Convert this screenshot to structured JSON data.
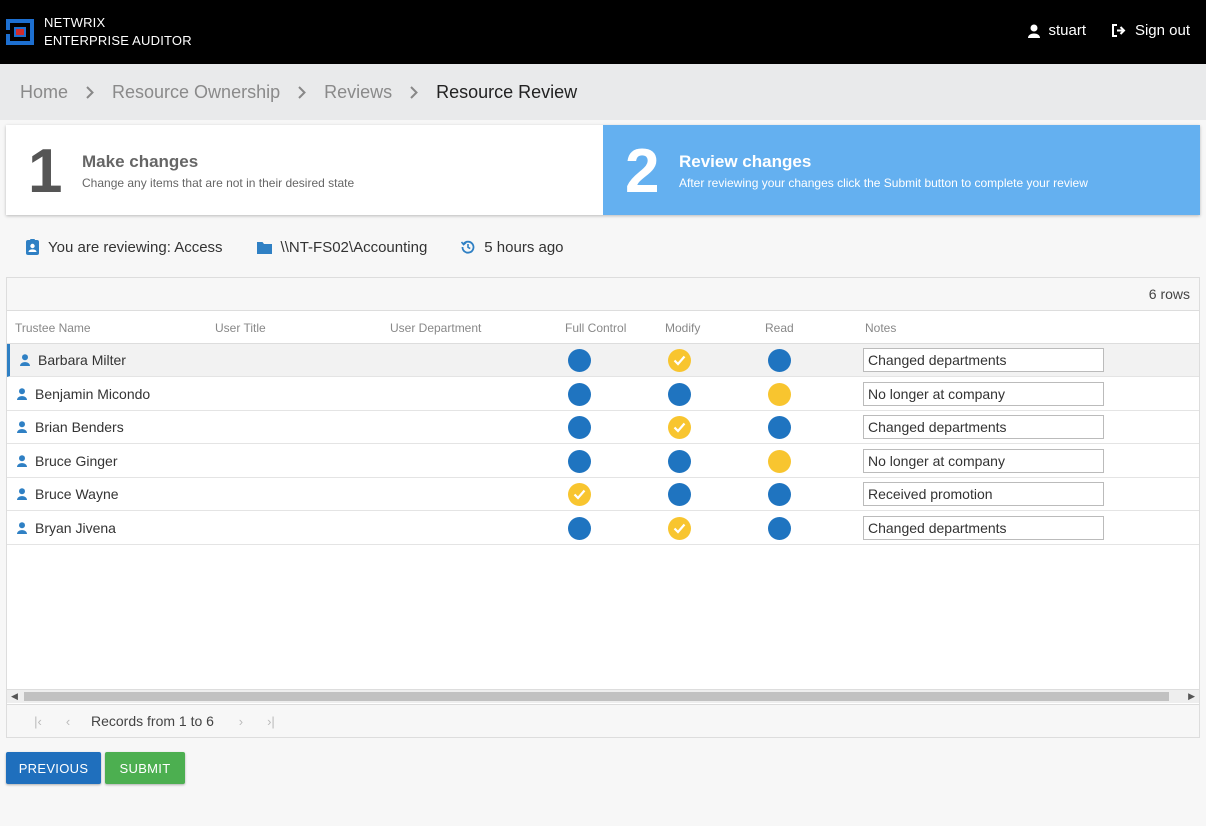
{
  "header": {
    "brand_line1": "NETWRIX",
    "brand_line2": "ENTERPRISE AUDITOR",
    "username": "stuart",
    "signout_label": "Sign out"
  },
  "breadcrumb": {
    "items": [
      "Home",
      "Resource Ownership",
      "Reviews"
    ],
    "current": "Resource Review"
  },
  "steps": [
    {
      "number": "1",
      "title": "Make changes",
      "description": "Change any items that are not in their desired state"
    },
    {
      "number": "2",
      "title": "Review changes",
      "description": "After reviewing your changes click the Submit button to complete your review"
    }
  ],
  "info": {
    "reviewing": "You are reviewing: Access",
    "path": "\\\\NT-FS02\\Accounting",
    "time": "5 hours ago"
  },
  "grid": {
    "row_count": "6 rows",
    "columns": [
      "Trustee Name",
      "User Title",
      "User Department",
      "Full Control",
      "Modify",
      "Read",
      "Notes"
    ],
    "rows": [
      {
        "name": "Barbara Milter",
        "title": "",
        "department": "",
        "full_control": "blue",
        "modify": "yellow-check",
        "read": "blue",
        "notes": "Changed departments"
      },
      {
        "name": "Benjamin Micondo",
        "title": "",
        "department": "",
        "full_control": "blue",
        "modify": "blue",
        "read": "yellow",
        "notes": "No longer at company"
      },
      {
        "name": "Brian Benders",
        "title": "",
        "department": "",
        "full_control": "blue",
        "modify": "yellow-check",
        "read": "blue",
        "notes": "Changed departments"
      },
      {
        "name": "Bruce Ginger",
        "title": "",
        "department": "",
        "full_control": "blue",
        "modify": "blue",
        "read": "yellow",
        "notes": "No longer at company"
      },
      {
        "name": "Bruce Wayne",
        "title": "",
        "department": "",
        "full_control": "yellow-check",
        "modify": "blue",
        "read": "blue",
        "notes": "Received promotion"
      },
      {
        "name": "Bryan Jivena",
        "title": "",
        "department": "",
        "full_control": "blue",
        "modify": "yellow-check",
        "read": "blue",
        "notes": "Changed departments"
      }
    ],
    "pager_text": "Records from 1 to 6"
  },
  "buttons": {
    "previous": "PREVIOUS",
    "submit": "SUBMIT"
  },
  "colors": {
    "header_bg": "#000000",
    "step2_bg": "#64b0f0",
    "status_blue": "#1f74c0",
    "status_yellow": "#f8c52f",
    "previous_button": "#1f6fbd",
    "submit_button": "#4caf50"
  },
  "icons": [
    "netwrix-logo-icon",
    "user-icon",
    "sign-out-icon",
    "chevron-right-icon",
    "clipboard-user-icon",
    "folder-icon",
    "history-icon",
    "check-icon"
  ]
}
